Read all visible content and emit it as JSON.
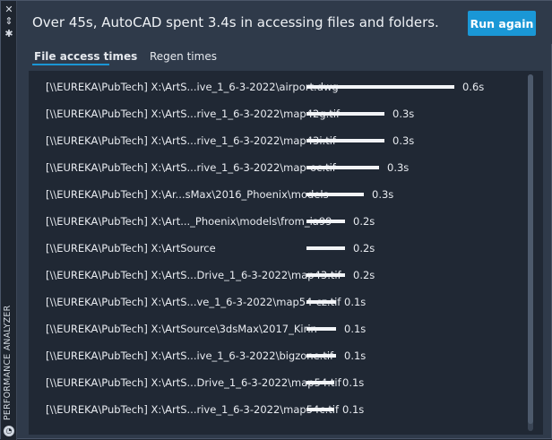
{
  "palette": {
    "title": "PERFORMANCE ANALYZER",
    "icons": [
      "close-icon",
      "pin-icon",
      "settings-icon",
      "analyzer-icon"
    ]
  },
  "header": {
    "summary": "Over 45s, AutoCAD spent 3.4s in accessing files and folders.",
    "run_again_label": "Run again"
  },
  "tabs": [
    {
      "label": "File access times",
      "active": true
    },
    {
      "label": "Regen times",
      "active": false
    }
  ],
  "rows": [
    {
      "path": "[\\\\EUREKA\\PubTech] X:\\ArtS...ive_1_6-3-2022\\airport.dwg",
      "seconds": 0.6,
      "label": "0.6s",
      "fill": 1.0
    },
    {
      "path": "[\\\\EUREKA\\PubTech] X:\\ArtS...rive_1_6-3-2022\\map42g.tif",
      "seconds": 0.3,
      "label": "0.3s",
      "fill": 0.53
    },
    {
      "path": "[\\\\EUREKA\\PubTech] X:\\ArtS...rive_1_6-3-2022\\map43i.tif",
      "seconds": 0.3,
      "label": "0.3s",
      "fill": 0.53
    },
    {
      "path": "[\\\\EUREKA\\PubTech] X:\\ArtS...rive_1_6-3-2022\\map-oc.tif",
      "seconds": 0.3,
      "label": "0.3s",
      "fill": 0.49
    },
    {
      "path": "[\\\\EUREKA\\PubTech] X:\\Ar...sMax\\2016_Phoenix\\models",
      "seconds": 0.3,
      "label": "0.3s",
      "fill": 0.39
    },
    {
      "path": "[\\\\EUREKA\\PubTech] X:\\Art..._Phoenix\\models\\from_ia99",
      "seconds": 0.2,
      "label": "0.2s",
      "fill": 0.26
    },
    {
      "path": "[\\\\EUREKA\\PubTech] X:\\ArtSource",
      "seconds": 0.2,
      "label": "0.2s",
      "fill": 0.26
    },
    {
      "path": "[\\\\EUREKA\\PubTech] X:\\ArtS...Drive_1_6-3-2022\\map43.tif",
      "seconds": 0.2,
      "label": "0.2s",
      "fill": 0.26
    },
    {
      "path": "[\\\\EUREKA\\PubTech] X:\\ArtS...ve_1_6-3-2022\\map54-cz.tif",
      "seconds": 0.1,
      "label": "0.1s",
      "fill": 0.2
    },
    {
      "path": "[\\\\EUREKA\\PubTech] X:\\ArtSource\\3dsMax\\2017_Kirin",
      "seconds": 0.1,
      "label": "0.1s",
      "fill": 0.2
    },
    {
      "path": "[\\\\EUREKA\\PubTech] X:\\ArtS...ive_1_6-3-2022\\bigzone.tif",
      "seconds": 0.1,
      "label": "0.1s",
      "fill": 0.2
    },
    {
      "path": "[\\\\EUREKA\\PubTech] X:\\ArtS...Drive_1_6-3-2022\\map54.tif",
      "seconds": 0.1,
      "label": "0.1s",
      "fill": 0.19
    },
    {
      "path": "[\\\\EUREKA\\PubTech] X:\\ArtS...rive_1_6-3-2022\\map54c.tif",
      "seconds": 0.1,
      "label": "0.1s",
      "fill": 0.19
    }
  ],
  "colors": {
    "accent": "#1a97d6",
    "panel_bg": "#202834",
    "header_bg": "#2f3a4a",
    "bar": "#f2f4f7"
  }
}
